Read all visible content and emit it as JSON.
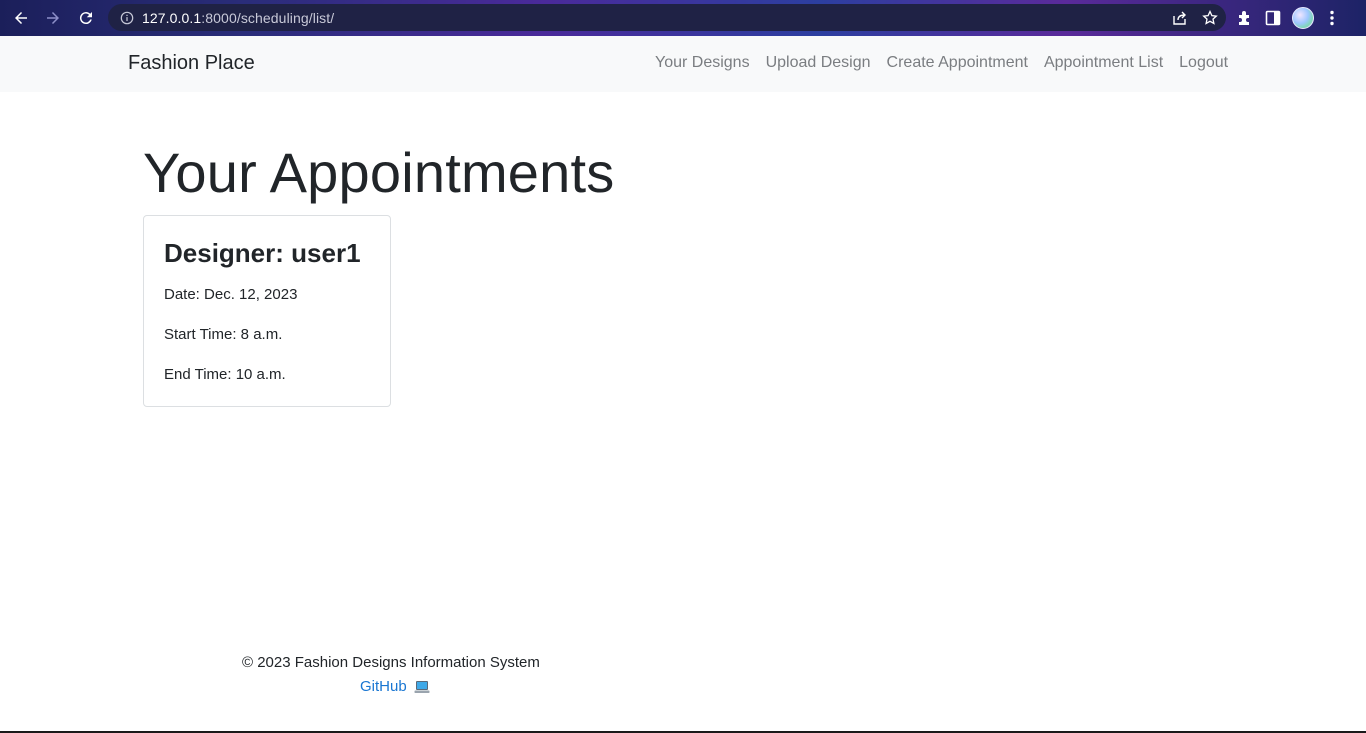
{
  "browser": {
    "url_host": "127.0.0.1",
    "url_rest": ":8000/scheduling/list/"
  },
  "navbar": {
    "brand": "Fashion Place",
    "links": [
      {
        "label": "Your Designs"
      },
      {
        "label": "Upload Design"
      },
      {
        "label": "Create Appointment"
      },
      {
        "label": "Appointment List"
      },
      {
        "label": "Logout"
      }
    ]
  },
  "main": {
    "title": "Your Appointments",
    "appointments": [
      {
        "designer": "Designer: user1",
        "date": "Date: Dec. 12, 2023",
        "start": "Start Time: 8 a.m.",
        "end": "End Time: 10 a.m."
      }
    ]
  },
  "footer": {
    "copyright": "© 2023 Fashion Designs Information System",
    "github_label": "GitHub"
  },
  "colors": {
    "navbar_bg": "#f8f9fa",
    "link": "#1976d2",
    "nav_link": "#7a7d81"
  },
  "icons": [
    "back-arrow-icon",
    "forward-arrow-icon",
    "reload-icon",
    "info-icon",
    "share-icon",
    "star-icon",
    "extensions-icon",
    "sidepanel-icon",
    "profile-avatar",
    "menu-dots-icon",
    "laptop-icon"
  ]
}
